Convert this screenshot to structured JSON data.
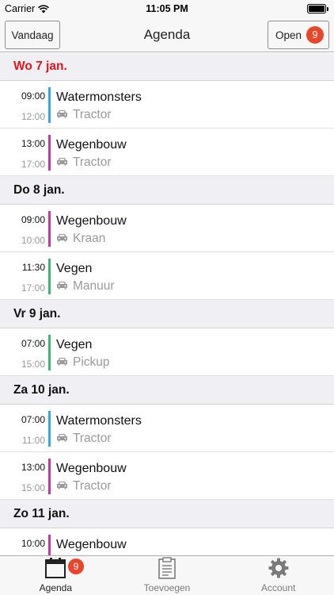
{
  "status_bar": {
    "carrier": "Carrier",
    "time": "11:05 PM"
  },
  "nav": {
    "title": "Agenda",
    "today_label": "Vandaag",
    "open_label": "Open",
    "open_count": "9"
  },
  "days": [
    {
      "label": "Wo 7 jan.",
      "is_today": true,
      "items": [
        {
          "start": "09:00",
          "end": "12:00",
          "title": "Watermonsters",
          "resource": "Tractor",
          "color": "#34aadc"
        },
        {
          "start": "13:00",
          "end": "17:00",
          "title": "Wegenbouw",
          "resource": "Tractor",
          "color": "#c2399b"
        }
      ]
    },
    {
      "label": "Do 8 jan.",
      "is_today": false,
      "items": [
        {
          "start": "09:00",
          "end": "10:00",
          "title": "Wegenbouw",
          "resource": "Kraan",
          "color": "#c2399b"
        },
        {
          "start": "11:30",
          "end": "17:00",
          "title": "Vegen",
          "resource": "Manuur",
          "color": "#3bb67a"
        }
      ]
    },
    {
      "label": "Vr 9 jan.",
      "is_today": false,
      "items": [
        {
          "start": "07:00",
          "end": "15:00",
          "title": "Vegen",
          "resource": "Pickup",
          "color": "#3bb67a"
        }
      ]
    },
    {
      "label": "Za 10 jan.",
      "is_today": false,
      "items": [
        {
          "start": "07:00",
          "end": "11:00",
          "title": "Watermonsters",
          "resource": "Tractor",
          "color": "#34aadc"
        },
        {
          "start": "13:00",
          "end": "15:00",
          "title": "Wegenbouw",
          "resource": "Tractor",
          "color": "#c2399b"
        }
      ]
    },
    {
      "label": "Zo 11 jan.",
      "is_today": false,
      "items": [
        {
          "start": "10:00",
          "end": "",
          "title": "Wegenbouw",
          "resource": "",
          "color": "#c2399b"
        }
      ]
    }
  ],
  "tabs": [
    {
      "label": "Agenda",
      "icon": "calendar-icon",
      "active": true,
      "badge": "9"
    },
    {
      "label": "Toevoegen",
      "icon": "clipboard-icon",
      "active": false
    },
    {
      "label": "Account",
      "icon": "gear-icon",
      "active": false
    }
  ],
  "colors": {
    "accent_red": "#e3141c",
    "badge_red": "#e8452c"
  }
}
